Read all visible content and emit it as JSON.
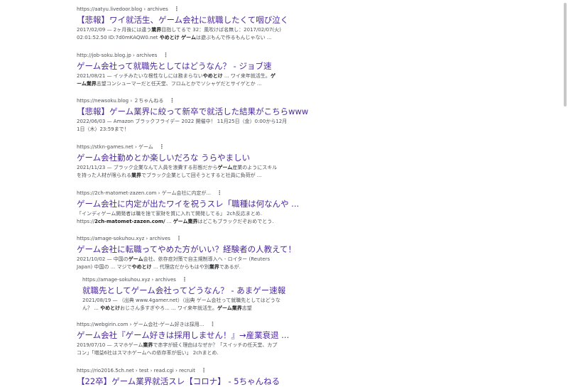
{
  "results": [
    {
      "cite": "https://aatyu.livedoor.blog › archives",
      "title": "【悲報】ワイ就活生、ゲーム会社に就職したくて咽び泣く",
      "snippet": [
        [
          "t",
          "2017/02/09 — 2ヶ月後には違う"
        ],
        [
          "b",
          "業界"
        ],
        [
          "t",
          "目指してるで 32：風吹けば名無し：2017/02/07(火)"
        ],
        [
          "br",
          ""
        ],
        [
          "t",
          "02:01:52.50 ID:7d0mKAQW0.net "
        ],
        [
          "b",
          "やめとけ ゲーム"
        ],
        [
          "t",
          "は遊ぶもんで作るもんじゃない ..."
        ]
      ]
    },
    {
      "cite": "http://job-soku.blog.jp › archives",
      "title": "ゲーム会社って就職先としてはどうなん？ - ジョブ速",
      "snippet": [
        [
          "t",
          "2021/08/21 — イッチみたいな根性なしには務まらない"
        ],
        [
          "b",
          "やめとけ"
        ],
        [
          "t",
          " ... ワイ来年就活生。"
        ],
        [
          "b",
          "ゲ"
        ],
        [
          "br",
          ""
        ],
        [
          "b",
          "ーム業界"
        ],
        [
          "t",
          "志望コンシューマーだと任天堂、フロムとかでソシャゲだとサイゲとか ..."
        ]
      ]
    },
    {
      "cite": "https://newsoku.blog › ２ちゃんねる",
      "title": "【悲報】ゲーム業界に絞って新卒で就活した結果がこちらwww",
      "snippet": [
        [
          "t",
          "2022/06/03 — Amazon ブラックフライデー 2022 開催中！ 11月25日（金）0:00から12月"
        ],
        [
          "br",
          ""
        ],
        [
          "t",
          "1日（木）23:59まで！"
        ]
      ]
    },
    {
      "cite": "https://stkn-games.net › ゲーム",
      "title": "ゲーム会社勤めとか楽しいだろな うらやましい",
      "snippet": [
        [
          "t",
          "2021/11/23 — ブラック企業なんて人員を浪費する形態だから"
        ],
        [
          "b",
          "ゲーム"
        ],
        [
          "t",
          "産業のようにスキル"
        ],
        [
          "br",
          ""
        ],
        [
          "t",
          "を持った人材が限られる"
        ],
        [
          "b",
          "業界"
        ],
        [
          "t",
          "でブラック企業として回そうとすると社員に負荷が ..."
        ]
      ]
    },
    {
      "cite": "https://2ch-matomet-zazen.com › ゲーム会社に内定が...",
      "title": "ゲーム会社に内定が出たワイを祝うスレ「職種は何なんや ...",
      "snippet": [
        [
          "t",
          "「インディゲーム開発者は職を捨て家財を質に入れて開発してる」 2ch反応まとめ."
        ],
        [
          "br",
          ""
        ],
        [
          "t",
          "https://"
        ],
        [
          "b",
          "2ch-matomet-zazen.com/"
        ],
        [
          "t",
          " ... "
        ],
        [
          "b",
          "ゲーム業界"
        ],
        [
          "t",
          "はどこもブラックだぞおめでとう."
        ]
      ]
    },
    {
      "cite": "https://amage-sokuhou.xyz › archives",
      "title": "ゲーム会社に転職ってやめた方がいい？経験者の人教えて！",
      "snippet": [
        [
          "t",
          "2021/10/02 — 中国の"
        ],
        [
          "b",
          "ゲーム"
        ],
        [
          "t",
          "会社、依存症対策で自主規制導入へ - ロイター (Reuters"
        ],
        [
          "br",
          ""
        ],
        [
          "t",
          "Japan) 中国の ... マジで"
        ],
        [
          "b",
          "やめとけ"
        ],
        [
          "t",
          " ... 代理店だからもはや別"
        ],
        [
          "b",
          "業界"
        ],
        [
          "t",
          "であるが."
        ]
      ]
    },
    {
      "cite": "https://amage-sokuhou.xyz › archives",
      "title": "就職先としてゲーム会社ってどうなん？ - あまゲー速報",
      "snippet": [
        [
          "t",
          "2021/08/19 — （出典 www.4gamer.net）（出典 ゲーム会社って就職先としてはどうな"
        ],
        [
          "br",
          ""
        ],
        [
          "t",
          "ん？ ... "
        ],
        [
          "b",
          "やめとけ"
        ],
        [
          "t",
          "おじさん多すぎやろ... ... ワイ来年就活生。"
        ],
        [
          "b",
          "ゲーム業界"
        ],
        [
          "t",
          "志望"
        ]
      ]
    },
    {
      "cite": "https://webgirin.com › ゲーム会社-ゲーム好きは採用...",
      "title": "ゲーム会社『ゲーム好きは採用しません！』→産業衰退 ...",
      "snippet": [
        [
          "t",
          "2019/07/10 — スマホゲーム"
        ],
        [
          "b",
          "業界"
        ],
        [
          "t",
          "で赤字が続く理由はなぜか？「スイッチの任天堂、カプ"
        ],
        [
          "br",
          ""
        ],
        [
          "t",
          "コン」「増益6社はスマホゲームへの依存率が低い」 2chまとめ."
        ]
      ]
    },
    {
      "cite": "https://rio2016.5ch.net › test › read.cgi › recruit",
      "title": "【22卒】ゲーム業界就活スレ【コロナ】 - 5ちゃんねる",
      "snippet": []
    }
  ]
}
